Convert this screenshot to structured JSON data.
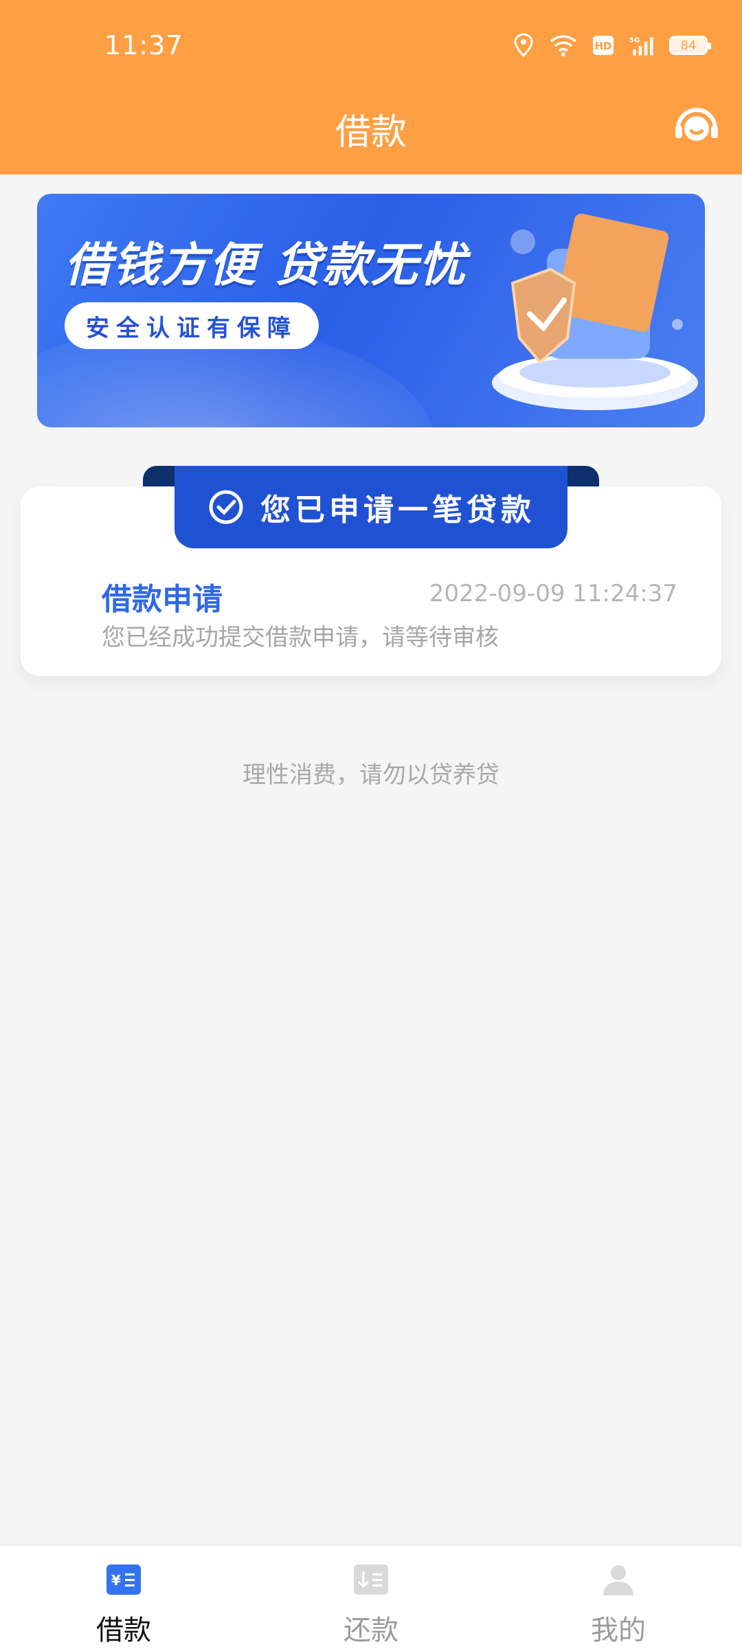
{
  "status_bar": {
    "time": "11:37",
    "battery": "84"
  },
  "header": {
    "title": "借款",
    "icon": "customer-service-icon"
  },
  "banner": {
    "headline": "借钱方便 贷款无忧",
    "pill_text": "安全认证有保障"
  },
  "loan_card": {
    "ribbon_text": "您已申请一笔贷款",
    "title": "借款申请",
    "datetime": "2022-09-09 11:24:37",
    "description": "您已经成功提交借款申请，请等待审核"
  },
  "notice": "理性消费，请勿以贷养贷",
  "bottom_nav": {
    "items": [
      {
        "label": "借款",
        "icon": "loan-icon",
        "active": true
      },
      {
        "label": "还款",
        "icon": "repay-icon",
        "active": false
      },
      {
        "label": "我的",
        "icon": "profile-icon",
        "active": false
      }
    ]
  },
  "colors": {
    "header": "#ff9f43",
    "primary": "#2151d3",
    "accent_text": "#2f69e3"
  }
}
